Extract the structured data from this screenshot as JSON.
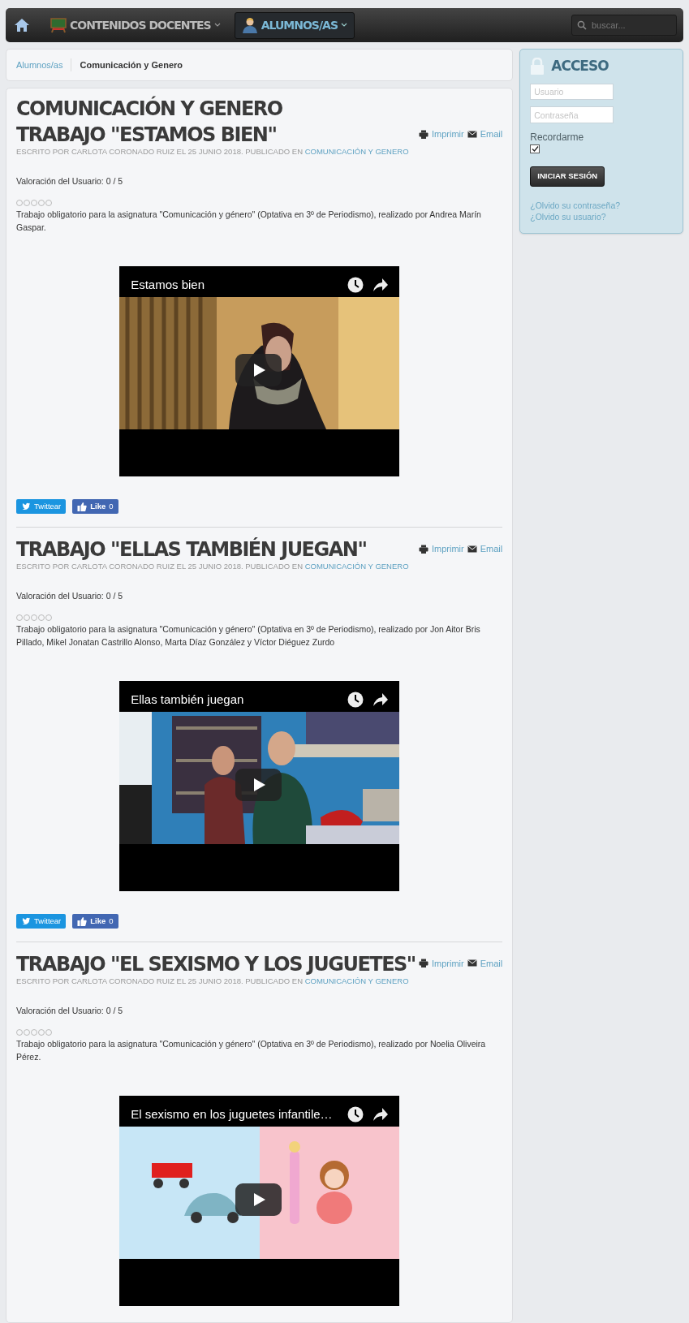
{
  "navbar": {
    "menus": [
      {
        "label": "CONTENIDOS DOCENTES",
        "selected": false
      },
      {
        "label": "ALUMNOS/AS",
        "selected": true
      }
    ],
    "search": {
      "placeholder": "buscar..."
    }
  },
  "breadcrumb": [
    {
      "label": "Alumnos/as",
      "kind": "link"
    },
    {
      "label": "Comunicación y Genero",
      "kind": "current"
    }
  ],
  "category_title": "COMUNICACIÓN Y GENERO",
  "articles": [
    {
      "title": "TRABAJO \"ESTAMOS BIEN\"",
      "actions": [
        "Imprimir",
        "Email"
      ],
      "byline": "ESCRITO POR CARLOTA CORONADO RUIZ EL 25 JUNIO 2018. PUBLICADO EN",
      "category": "COMUNICACIÓN Y GENERO",
      "rating": "Valoración del Usuario: 0 / 5",
      "stars": 0,
      "description": "Trabajo obligatorio para la asignatura \"Comunicación y género\" (Optativa en 3º de Periodismo), realizado por Andrea Marín Gaspar.",
      "video": {
        "title": "Estamos bien",
        "kind": "picture"
      },
      "share": {
        "tweet": "Twittear",
        "like": "Like",
        "like_count": "0"
      }
    },
    {
      "title": "TRABAJO \"ELLAS TAMBIÉN JUEGAN\"",
      "actions": [
        "Imprimir",
        "Email"
      ],
      "byline": "ESCRITO POR CARLOTA CORONADO RUIZ EL 25 JUNIO 2018. PUBLICADO EN",
      "category": "COMUNICACIÓN Y GENERO",
      "rating": "Valoración del Usuario: 0 / 5",
      "stars": 0,
      "description": "Trabajo obligatorio para la asignatura \"Comunicación y género\" (Optativa en 3º de Periodismo), realizado por Jon Aitor Bris Pillado, Mikel Jonatan Castrillo Alonso, Marta Díaz González y Víctor Diéguez Zurdo",
      "video": {
        "title": "Ellas también juegan",
        "kind": "picture"
      },
      "share": {
        "tweet": "Twittear",
        "like": "Like",
        "like_count": "0"
      }
    },
    {
      "title": "TRABAJO \"EL SEXISMO Y LOS JUGUETES\"",
      "actions": [
        "Imprimir",
        "Email"
      ],
      "byline": "ESCRITO POR CARLOTA CORONADO RUIZ EL 25 JUNIO 2018. PUBLICADO EN",
      "category": "COMUNICACIÓN Y GENERO",
      "rating": "Valoración del Usuario: 0 / 5",
      "stars": 0,
      "description": "Trabajo obligatorio para la asignatura \"Comunicación y género\" (Optativa en 3º de Periodismo), realizado por Noelia Oliveira Pérez.",
      "video": {
        "title": "El sexismo en los juguetes infantile…",
        "kind": "picture"
      }
    }
  ],
  "login": {
    "title": "ACCESO",
    "username_placeholder": "Usuario",
    "password_placeholder": "Contraseña",
    "remember_label": "Recordarme",
    "remember": true,
    "button": "INICIAR SESIÓN",
    "links": [
      "¿Olvido su contraseña?",
      "¿Olvido su usuario?"
    ]
  }
}
